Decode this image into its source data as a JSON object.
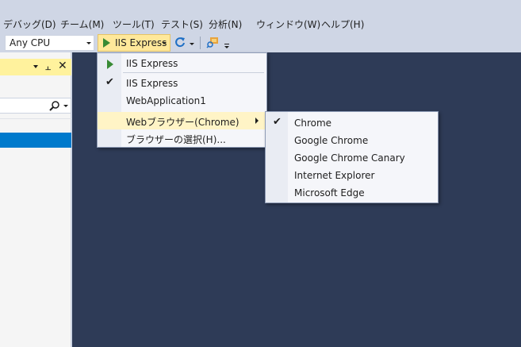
{
  "menubar": {
    "items": [
      "デバッグ(D)",
      "チーム(M)",
      "ツール(T)",
      "テスト(S)",
      "分析(N)",
      "ウィンドウ(W)",
      "ヘルプ(H)"
    ]
  },
  "toolbar": {
    "platform_value": "Any CPU",
    "run_target_label": "IIS Express"
  },
  "panel": {
    "search_placeholder": ""
  },
  "run_dropdown": {
    "items": [
      {
        "label": "IIS Express",
        "icon": "play-icon"
      },
      {
        "label": "IIS Express",
        "checked": true
      },
      {
        "label": "WebApplication1"
      },
      {
        "label": "Webブラウザー(Chrome)",
        "has_submenu": true,
        "highlighted": true
      },
      {
        "label": "ブラウザーの選択(H)..."
      }
    ]
  },
  "browser_submenu": {
    "items": [
      {
        "label": "Chrome",
        "checked": true
      },
      {
        "label": "Google Chrome"
      },
      {
        "label": "Google Chrome Canary"
      },
      {
        "label": "Internet Explorer"
      },
      {
        "label": "Microsoft Edge"
      }
    ]
  },
  "colors": {
    "chrome_bg": "#cfd6e5",
    "editor_bg": "#2e3b57",
    "highlight": "#fff4c6",
    "run_button_bg": "#ffe89a",
    "play_green": "#388a34",
    "selection_blue": "#007acc"
  }
}
